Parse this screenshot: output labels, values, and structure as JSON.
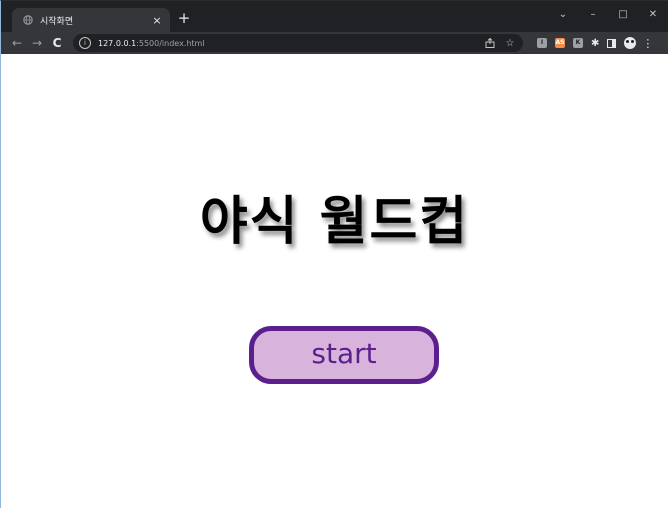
{
  "browser": {
    "tab": {
      "title": "시작화면",
      "favicon": "globe-icon",
      "close_label": "×"
    },
    "new_tab_label": "+",
    "window_controls": {
      "dropdown": "⌄",
      "minimize": "–",
      "maximize": "□",
      "close": "✕"
    },
    "nav": {
      "back": "←",
      "forward": "→",
      "reload": "C"
    },
    "omnibox": {
      "url_host": "127.0.0.1",
      "url_rest": ":5500/index.html"
    },
    "extensions": [
      {
        "name": "ext-1",
        "label": "I"
      },
      {
        "name": "ext-2",
        "label": "AS"
      },
      {
        "name": "ext-3",
        "label": "K"
      }
    ]
  },
  "page": {
    "title": "야식 월드컵",
    "start_button_label": "start"
  },
  "colors": {
    "button_border": "#5b1f8e",
    "button_fill": "#d8b4dc",
    "button_text": "#5b1f8e",
    "title_text": "#000000",
    "browser_frame": "#202124",
    "toolbar": "#35363a"
  }
}
